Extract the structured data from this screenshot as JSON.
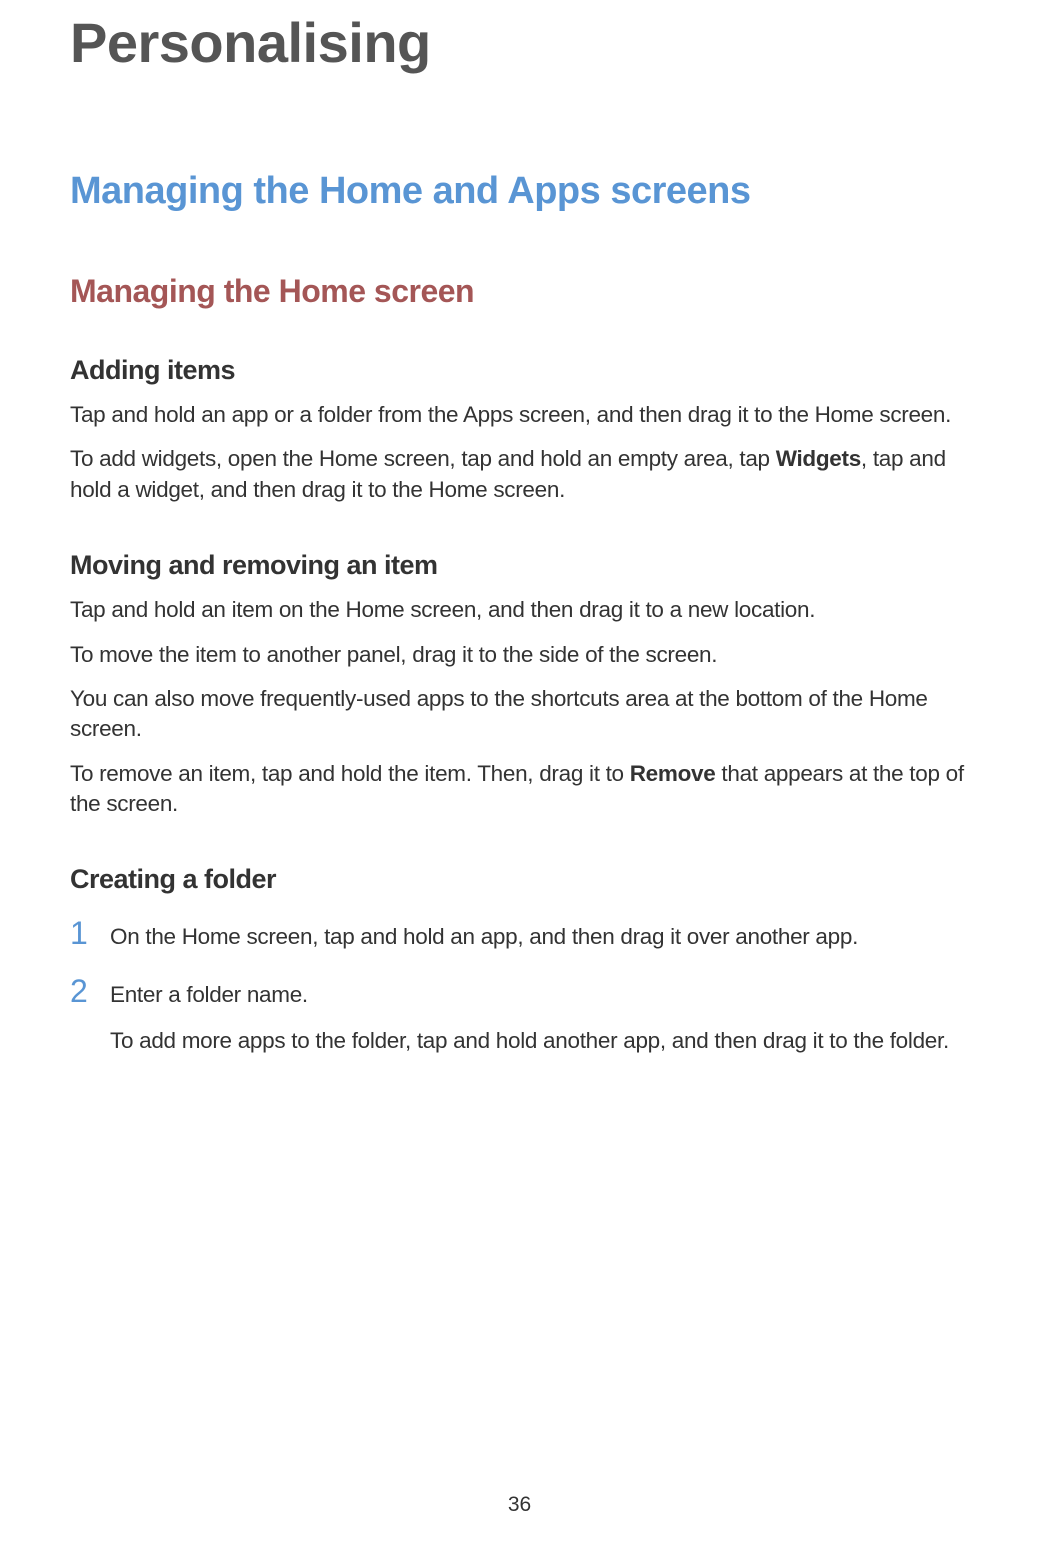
{
  "title": "Personalising",
  "section": "Managing the Home and Apps screens",
  "subsection": "Managing the Home screen",
  "topics": {
    "adding": {
      "heading": "Adding items",
      "p1_pre": "Tap and hold an app or a folder from the Apps screen, and then drag it to the Home screen.",
      "p2_pre": "To add widgets, open the Home screen, tap and hold an empty area, tap ",
      "p2_bold": "Widgets",
      "p2_post": ", tap and hold a widget, and then drag it to the Home screen."
    },
    "moving": {
      "heading": "Moving and removing an item",
      "p1": "Tap and hold an item on the Home screen, and then drag it to a new location.",
      "p2": "To move the item to another panel, drag it to the side of the screen.",
      "p3": "You can also move frequently-used apps to the shortcuts area at the bottom of the Home screen.",
      "p4_pre": "To remove an item, tap and hold the item. Then, drag it to ",
      "p4_bold": "Remove",
      "p4_post": " that appears at the top of the screen."
    },
    "folder": {
      "heading": "Creating a folder",
      "step1_num": "1",
      "step1": "On the Home screen, tap and hold an app, and then drag it over another app.",
      "step2_num": "2",
      "step2": "Enter a folder name.",
      "step2_sub": "To add more apps to the folder, tap and hold another app, and then drag it to the folder."
    }
  },
  "page_number": "36"
}
